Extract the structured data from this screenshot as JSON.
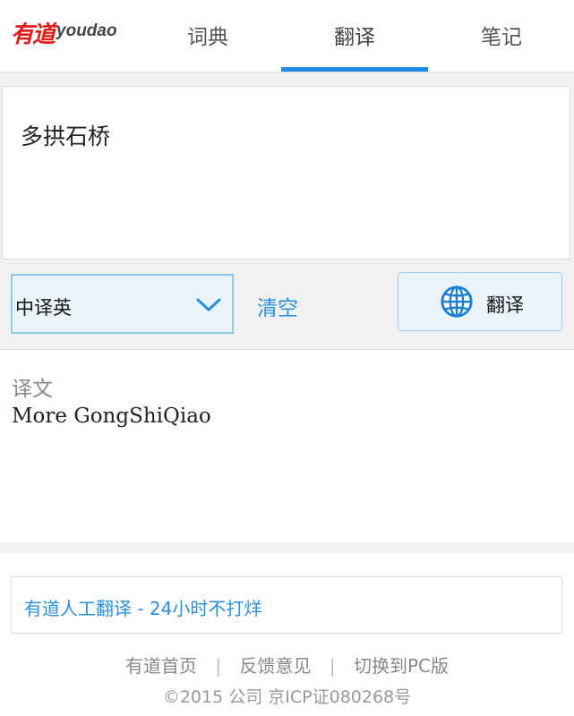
{
  "header": {
    "logo_cn": "有道",
    "logo_en": "youdao",
    "tabs": [
      {
        "label": "词典"
      },
      {
        "label": "翻译"
      },
      {
        "label": "笔记"
      }
    ],
    "accent_color": "#1e88e5",
    "brand_color": "#e21b1b"
  },
  "input": {
    "value": "多拱石桥"
  },
  "controls": {
    "language_selected": "中译英",
    "clear_label": "清空",
    "translate_label": "翻译",
    "icons": [
      "chevron-down-icon",
      "globe-icon"
    ]
  },
  "result": {
    "heading": "译文",
    "text": "More GongShiQiao"
  },
  "promo": {
    "text": "有道人工翻译 - 24小时不打烊"
  },
  "footer": {
    "links": [
      {
        "label": "有道首页"
      },
      {
        "label": "反馈意见"
      },
      {
        "label": "切换到PC版"
      }
    ],
    "separator": "|",
    "copyright": "©2015 公司 京ICP证080268号"
  }
}
